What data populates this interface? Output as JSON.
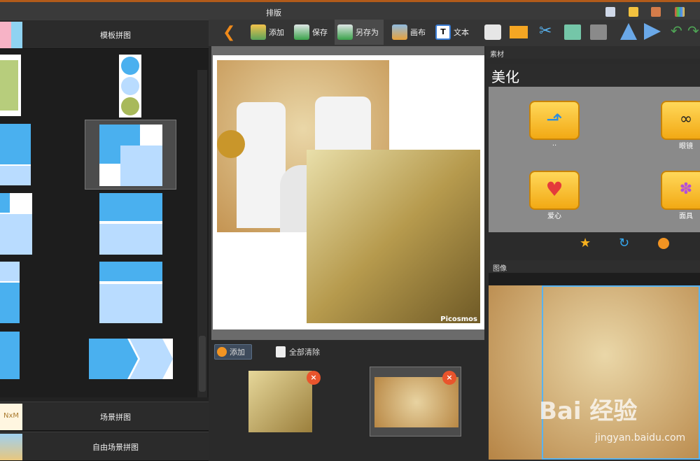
{
  "window": {
    "title": "排版"
  },
  "left": {
    "template_label": "模板拼图",
    "scene_label": "场景拼图",
    "free_scene_label": "自由场景拼图",
    "nxm": "NxM"
  },
  "toolbar": {
    "add": "添加",
    "save": "保存",
    "save_as": "另存为",
    "canvas": "画布",
    "text": "文本"
  },
  "bottom": {
    "add": "添加",
    "clear_all": "全部清除"
  },
  "right": {
    "material_header": "素材",
    "category": "美化",
    "items": [
      "..",
      "眼镜",
      "爱心",
      "面具"
    ],
    "image_header": "图像"
  },
  "canvas": {
    "caption": "Picosmos"
  },
  "watermark": {
    "brand": "Bai 经验",
    "url": "jingyan.baidu.com"
  },
  "colors": {
    "accent": "#4ab0ef",
    "light": "#b9dcff",
    "folder": "#f2b41f"
  }
}
